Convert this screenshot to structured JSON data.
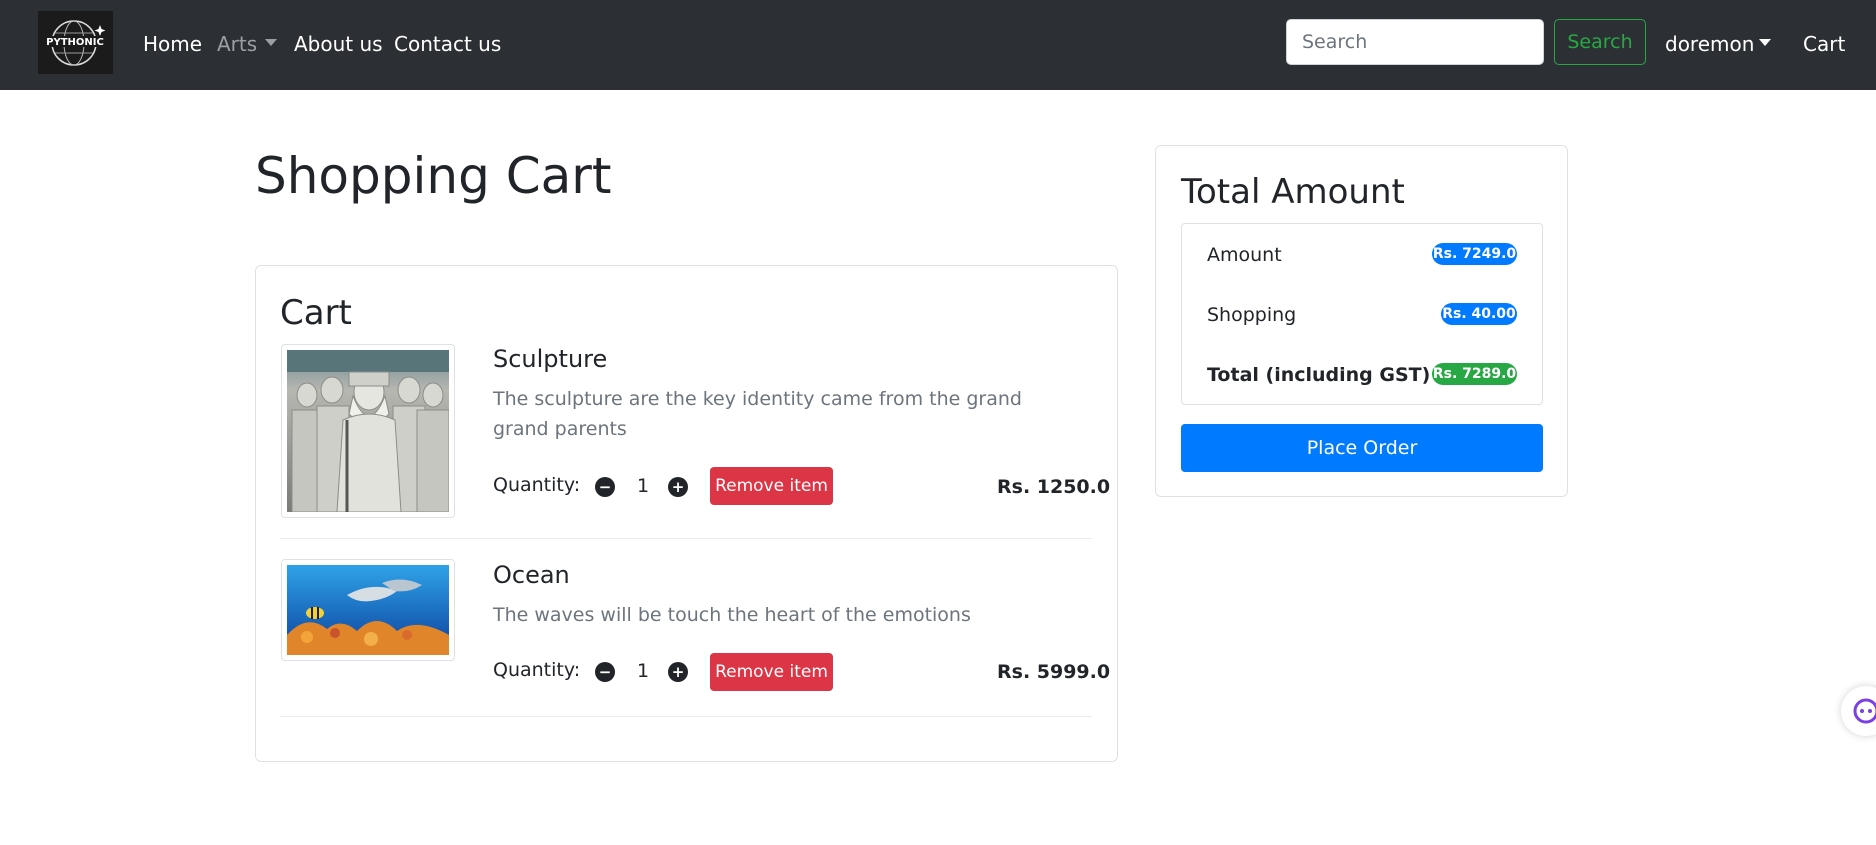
{
  "navbar": {
    "brand_logo_text": "PYTHONIC",
    "links": {
      "home": "Home",
      "arts": "Arts",
      "about": "About us",
      "contact": "Contact us"
    },
    "search": {
      "placeholder": "Search",
      "button_label": "Search"
    },
    "user_menu_label": "doremon",
    "cart_link": "Cart"
  },
  "page": {
    "title": "Shopping Cart"
  },
  "cart": {
    "heading": "Cart",
    "quantity_label": "Quantity:",
    "remove_label": "Remove item",
    "items": [
      {
        "name": "Sculpture",
        "description": "The sculpture are the key identity came from the grand grand parents",
        "quantity": "1",
        "price": "Rs. 1250.0",
        "image": "sculpture-image"
      },
      {
        "name": "Ocean",
        "description": "The waves will be touch the heart of the emotions",
        "quantity": "1",
        "price": "Rs. 5999.0",
        "image": "ocean-image"
      }
    ]
  },
  "summary": {
    "heading": "Total Amount",
    "rows": [
      {
        "label": "Amount",
        "value": "Rs. 7249.0",
        "color": "#007bff"
      },
      {
        "label": "Shopping",
        "value": "Rs. 40.00",
        "color": "#007bff"
      },
      {
        "label": "Total (including GST)",
        "value": "Rs. 7289.0",
        "color": "#28a745"
      }
    ],
    "place_order_label": "Place Order"
  },
  "colors": {
    "navbar_bg": "#2c3035",
    "primary": "#007bff",
    "success": "#28a745",
    "danger": "#dc3545"
  }
}
